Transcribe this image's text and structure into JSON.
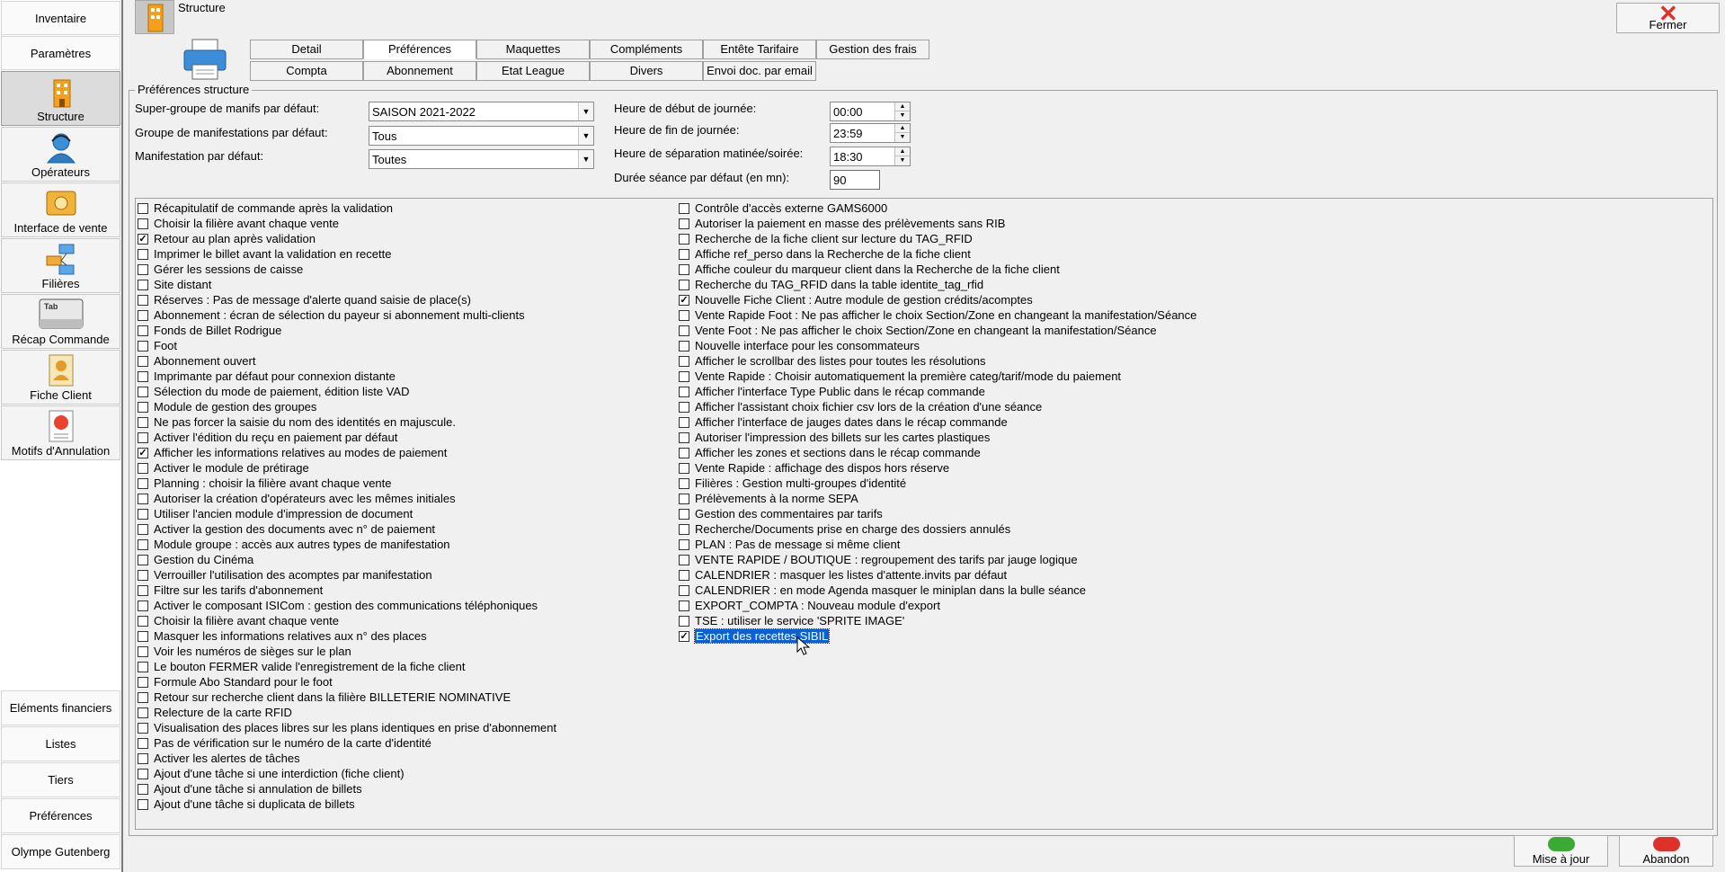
{
  "sidebar": {
    "top_buttons": [
      {
        "label": "Inventaire"
      },
      {
        "label": "Paramètres"
      }
    ],
    "icon_buttons": [
      {
        "label": "Structure",
        "icon": "building-icon"
      },
      {
        "label": "Opérateurs",
        "icon": "operator-icon"
      },
      {
        "label": "Interface de vente",
        "icon": "cash-register-icon"
      },
      {
        "label": "Filières",
        "icon": "network-icon"
      },
      {
        "label": "Récap Commande",
        "icon": "keyboard-tab-icon"
      },
      {
        "label": "Fiche Client",
        "icon": "client-card-icon"
      },
      {
        "label": "Motifs d'Annulation",
        "icon": "cancel-document-icon"
      }
    ],
    "bottom_buttons": [
      {
        "label": "Eléments financiers"
      },
      {
        "label": "Listes"
      },
      {
        "label": "Tiers"
      },
      {
        "label": "Préférences"
      },
      {
        "label": "Olympe Gutenberg"
      }
    ]
  },
  "header": {
    "title": "Structure",
    "close_label": "Fermer"
  },
  "tabs": [
    {
      "label": "Detail"
    },
    {
      "label": "Préférences"
    },
    {
      "label": "Maquettes"
    },
    {
      "label": "Compléments"
    },
    {
      "label": "Entête Tarifaire"
    },
    {
      "label": "Gestion des frais"
    },
    {
      "label": "Compta"
    },
    {
      "label": "Abonnement"
    },
    {
      "label": "Etat League"
    },
    {
      "label": "Divers"
    },
    {
      "label": "Envoi doc. par email"
    }
  ],
  "group": {
    "title": "Préférences structure"
  },
  "fields": {
    "supergroup": {
      "label": "Super-groupe de manifs par défaut:",
      "value": "SAISON 2021-2022"
    },
    "group": {
      "label": "Groupe de manifestations par défaut:",
      "value": "Tous"
    },
    "manif": {
      "label": "Manifestation par défaut:",
      "value": "Toutes"
    },
    "start": {
      "label": "Heure de début de journée:",
      "value": "00:00"
    },
    "end": {
      "label": "Heure de fin de journée:",
      "value": "23:59"
    },
    "split": {
      "label": "Heure de séparation matinée/soirée:",
      "value": "18:30"
    },
    "duration": {
      "label": "Durée séance par défaut (en mn):",
      "value": "90"
    }
  },
  "options_left": [
    {
      "label": "Récapitulatif de commande après la validation",
      "checked": false
    },
    {
      "label": "Choisir la filière avant chaque vente",
      "checked": false
    },
    {
      "label": "Retour au plan après validation",
      "checked": true
    },
    {
      "label": "Imprimer le billet avant la validation en recette",
      "checked": false
    },
    {
      "label": "Gérer les sessions de caisse",
      "checked": false
    },
    {
      "label": "Site distant",
      "checked": false
    },
    {
      "label": "Réserves : Pas de message d'alerte quand saisie de place(s)",
      "checked": false
    },
    {
      "label": "Abonnement : écran de sélection du payeur si abonnement multi-clients",
      "checked": false
    },
    {
      "label": "Fonds de Billet Rodrigue",
      "checked": false
    },
    {
      "label": "Foot",
      "checked": false
    },
    {
      "label": "Abonnement ouvert",
      "checked": false
    },
    {
      "label": "Imprimante par défaut pour connexion distante",
      "checked": false
    },
    {
      "label": "Sélection du mode de paiement, édition liste VAD",
      "checked": false
    },
    {
      "label": "Module de gestion des groupes",
      "checked": false
    },
    {
      "label": "Ne pas forcer la saisie du nom des identités en majuscule.",
      "checked": false
    },
    {
      "label": "Activer l'édition du reçu en paiement par défaut",
      "checked": false
    },
    {
      "label": "Afficher les informations relatives au modes de paiement",
      "checked": true
    },
    {
      "label": "Activer le module de prétirage",
      "checked": false
    },
    {
      "label": "Planning : choisir la filière avant chaque vente",
      "checked": false
    },
    {
      "label": "Autoriser la création d'opérateurs avec les mêmes initiales",
      "checked": false
    },
    {
      "label": "Utiliser l'ancien module d'impression de document",
      "checked": false
    },
    {
      "label": "Activer la gestion des documents avec n° de paiement",
      "checked": false
    },
    {
      "label": "Module groupe : accès aux autres types de manifestation",
      "checked": false
    },
    {
      "label": "Gestion du Cinéma",
      "checked": false
    },
    {
      "label": "Verrouiller l'utilisation des acomptes par manifestation",
      "checked": false
    },
    {
      "label": "Filtre sur les tarifs d'abonnement",
      "checked": false
    },
    {
      "label": "Activer le composant ISICom : gestion des communications téléphoniques",
      "checked": false
    },
    {
      "label": "Choisir la filière avant chaque vente",
      "checked": false
    },
    {
      "label": "Masquer les informations relatives aux n° des places",
      "checked": false
    },
    {
      "label": "Voir les numéros de sièges sur le plan",
      "checked": false
    },
    {
      "label": "Le bouton FERMER valide l'enregistrement de la fiche client",
      "checked": false
    },
    {
      "label": "Formule Abo Standard pour le foot",
      "checked": false
    },
    {
      "label": "Retour sur recherche client dans la filière BILLETERIE NOMINATIVE",
      "checked": false
    },
    {
      "label": "Relecture de la carte RFID",
      "checked": false
    },
    {
      "label": "Visualisation des places libres sur les plans identiques en prise d'abonnement",
      "checked": false
    },
    {
      "label": "Pas de vérification sur le numéro de la carte d'identité",
      "checked": false
    },
    {
      "label": "Activer les alertes de tâches",
      "checked": false
    },
    {
      "label": "Ajout d'une tâche si une interdiction (fiche client)",
      "checked": false
    },
    {
      "label": "Ajout d'une tâche si annulation de billets",
      "checked": false
    },
    {
      "label": "Ajout d'une tâche si duplicata de billets",
      "checked": false
    }
  ],
  "options_right": [
    {
      "label": "Contrôle d'accès externe GAMS6000",
      "checked": false
    },
    {
      "label": "Autoriser la paiement en masse des prélèvements sans RIB",
      "checked": false
    },
    {
      "label": "Recherche de la fiche client sur lecture du TAG_RFID",
      "checked": false
    },
    {
      "label": "Affiche ref_perso dans la Recherche de la fiche client",
      "checked": false
    },
    {
      "label": "Affiche couleur du marqueur client dans la Recherche de la fiche client",
      "checked": false
    },
    {
      "label": "Recherche du TAG_RFID dans la table identite_tag_rfid",
      "checked": false
    },
    {
      "label": "Nouvelle Fiche Client : Autre module de gestion crédits/acomptes",
      "checked": true
    },
    {
      "label": "Vente Rapide Foot : Ne pas afficher le choix Section/Zone en changeant la manifestation/Séance",
      "checked": false
    },
    {
      "label": "Vente Foot : Ne pas afficher le choix Section/Zone en changeant la manifestation/Séance",
      "checked": false
    },
    {
      "label": "Nouvelle interface pour les consommateurs",
      "checked": false
    },
    {
      "label": "Afficher le scrollbar des listes pour toutes les résolutions",
      "checked": false
    },
    {
      "label": "Vente Rapide : Choisir automatiquement la première categ/tarif/mode du paiement",
      "checked": false
    },
    {
      "label": "Afficher l'interface Type Public dans le récap commande",
      "checked": false
    },
    {
      "label": "Afficher l'assistant choix fichier csv lors de la création d'une séance",
      "checked": false
    },
    {
      "label": "Afficher l'interface de jauges dates dans le récap commande",
      "checked": false
    },
    {
      "label": "Autoriser l'impression des billets sur les cartes plastiques",
      "checked": false
    },
    {
      "label": "Afficher les zones et sections dans le récap commande",
      "checked": false
    },
    {
      "label": "Vente Rapide : affichage des dispos hors réserve",
      "checked": false
    },
    {
      "label": "Filières : Gestion multi-groupes d'identité",
      "checked": false
    },
    {
      "label": "Prélèvements à la norme SEPA",
      "checked": false
    },
    {
      "label": "Gestion des commentaires par tarifs",
      "checked": false
    },
    {
      "label": "Recherche/Documents prise en charge des dossiers annulés",
      "checked": false
    },
    {
      "label": "PLAN : Pas de message si même client",
      "checked": false
    },
    {
      "label": "VENTE RAPIDE / BOUTIQUE : regroupement des tarifs par jauge logique",
      "checked": false
    },
    {
      "label": "CALENDRIER : masquer les listes d'attente.invits par défaut",
      "checked": false
    },
    {
      "label": "CALENDRIER : en mode Agenda masquer le miniplan dans la bulle séance",
      "checked": false
    },
    {
      "label": "EXPORT_COMPTA : Nouveau module d'export",
      "checked": false
    },
    {
      "label": "TSE : utiliser le service 'SPRITE IMAGE'",
      "checked": false
    },
    {
      "label": "Export des recettes SIBIL",
      "checked": true,
      "selected": true
    }
  ],
  "buttons": {
    "update": "Mise à jour",
    "cancel": "Abandon"
  },
  "colors": {
    "selection": "#0a60d8",
    "close_red": "#e0302a",
    "update_green": "#3aaa35"
  }
}
